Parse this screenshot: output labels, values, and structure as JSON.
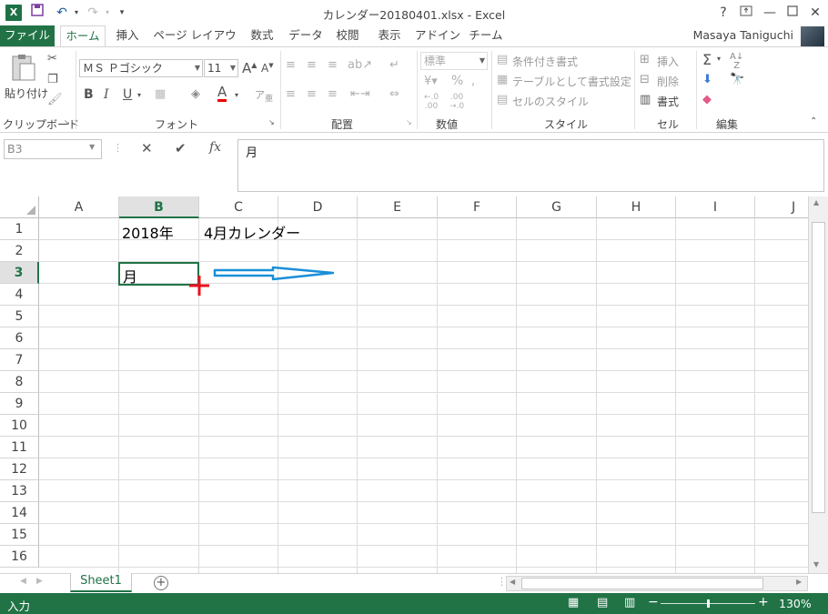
{
  "titlebar": {
    "title": "カレンダー20180401.xlsx - Excel",
    "help": "?",
    "min": "—",
    "close": "✕"
  },
  "tabs": [
    "ファイル",
    "ホーム",
    "挿入",
    "ページ レイアウト",
    "数式",
    "データ",
    "校閲",
    "表示",
    "アドイン",
    "チーム"
  ],
  "user": "Masaya Taniguchi",
  "ribbon": {
    "paste": "貼り付け",
    "clipboard": "クリップボード",
    "font_name": "ＭＳ Ｐゴシック",
    "font_size": "11",
    "font_group": "フォント",
    "align_group": "配置",
    "number_format": "標準",
    "number_group": "数値",
    "cond_format": "条件付き書式",
    "table_format": "テーブルとして書式設定",
    "cell_style": "セルのスタイル",
    "style_group": "スタイル",
    "insert": "挿入",
    "delete": "削除",
    "format": "書式",
    "cells_group": "セル",
    "edit_group": "編集",
    "bold": "B",
    "italic": "I",
    "underline": "U",
    "font_color_icon": "A",
    "percent": "%",
    "fx": "fx"
  },
  "formula": {
    "namebox": "B3",
    "content": "月"
  },
  "grid": {
    "columns": [
      "A",
      "B",
      "C",
      "D",
      "E",
      "F",
      "G",
      "H",
      "I",
      "J"
    ],
    "selected_col": "B",
    "rows": [
      "1",
      "2",
      "3",
      "4",
      "5",
      "6",
      "7",
      "8",
      "9",
      "10",
      "11",
      "12",
      "13",
      "14",
      "15",
      "16"
    ],
    "selected_row": "3",
    "b1": "2018年",
    "c1": "4月カレンダー",
    "b3": "月"
  },
  "sheets": {
    "active": "Sheet1"
  },
  "status": {
    "mode": "入力",
    "zoom": "130%"
  }
}
